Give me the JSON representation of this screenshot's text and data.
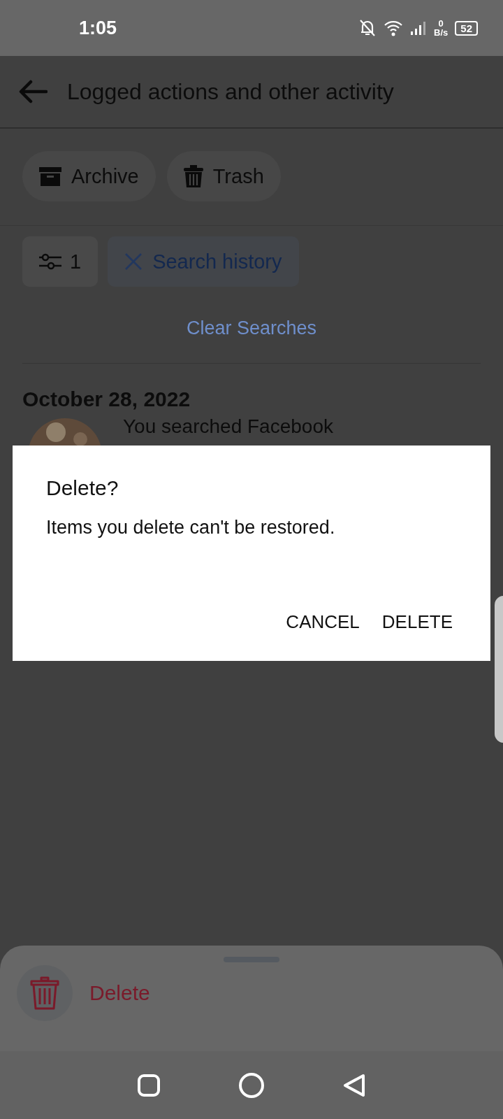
{
  "status_bar": {
    "time": "1:05",
    "speed_value": "0",
    "speed_unit": "B/s",
    "battery": "52"
  },
  "app_bar": {
    "title": "Logged actions and other activity"
  },
  "views": [
    {
      "label": "Archive",
      "kind": "archive"
    },
    {
      "label": "Trash",
      "kind": "trash"
    }
  ],
  "filter_bar": {
    "count": "1",
    "active_filter": "Search history"
  },
  "clear_link": "Clear Searches",
  "sections": [
    {
      "date": "October 28, 2022",
      "items": [
        {
          "text": "You searched Facebook"
        }
      ]
    }
  ],
  "dialog": {
    "title": "Delete?",
    "message": "Items you delete can't be restored.",
    "buttons": [
      "CANCEL",
      "DELETE"
    ]
  },
  "bottom_sheet": {
    "actions": [
      {
        "label": "Delete",
        "kind": "delete"
      }
    ]
  }
}
